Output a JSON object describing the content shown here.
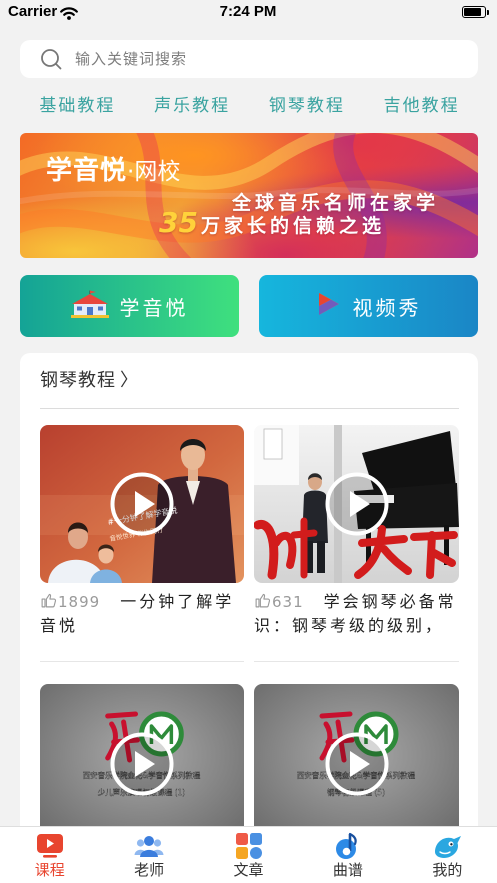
{
  "status_bar": {
    "carrier": "Carrier",
    "time": "7:24 PM"
  },
  "search": {
    "placeholder": "输入关键词搜索",
    "icon": "search-icon"
  },
  "categories": [
    {
      "label": "基础教程"
    },
    {
      "label": "声乐教程"
    },
    {
      "label": "钢琴教程"
    },
    {
      "label": "吉他教程"
    }
  ],
  "banner": {
    "brand": "学音悦",
    "brand_suffix": "·网校",
    "headline": "全球音乐名师在家学",
    "highlight_number": "35",
    "subline": "万家长的信赖之选"
  },
  "quick_links": [
    {
      "label": "学音悦",
      "icon": "school-icon"
    },
    {
      "label": "视频秀",
      "icon": "video-show-icon"
    }
  ],
  "section": {
    "title": "钢琴教程",
    "chevron": "〉"
  },
  "videos": [
    {
      "likes": "1899",
      "title": "一分钟了解学音悦",
      "thumbnail_text": [
        "#一分钟了解学音悦",
        "音悦世界 伴你同行"
      ]
    },
    {
      "likes": "631",
      "title": "学会钢琴必备常识：钢琴考级的级别，"
    },
    {
      "thumbnail_text": [
        "西安音乐学院金花&学音悦系列教程",
        "少儿声乐演唱初级课程 (1)"
      ]
    },
    {
      "thumbnail_text": [
        "西安音乐学院金花&学音悦系列教程",
        "钢琴初级课程 (5)"
      ]
    }
  ],
  "tab_bar": {
    "items": [
      {
        "label": "课程",
        "icon": "course-icon",
        "active": true
      },
      {
        "label": "老师",
        "icon": "teacher-icon",
        "active": false
      },
      {
        "label": "文章",
        "icon": "article-icon",
        "active": false
      },
      {
        "label": "曲谱",
        "icon": "sheet-music-icon",
        "active": false
      },
      {
        "label": "我的",
        "icon": "profile-icon",
        "active": false
      }
    ]
  },
  "colors": {
    "accent": "#3aa3a0",
    "active_tab": "#e8452f",
    "banner_highlight": "#ffd23a",
    "quick_link_left": [
      "#14a396",
      "#3fe07e"
    ],
    "quick_link_right": [
      "#16b6dd",
      "#1a86c6"
    ]
  }
}
